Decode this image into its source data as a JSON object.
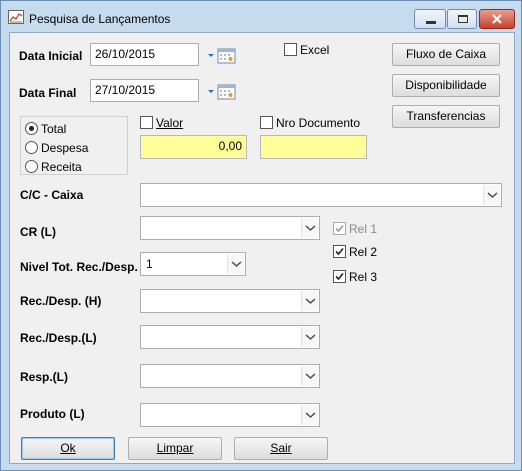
{
  "window": {
    "title": "Pesquisa de Lançamentos"
  },
  "dates": {
    "initial_label": "Data Inicial",
    "initial_value": "26/10/2015",
    "final_label": "Data Final",
    "final_value": "27/10/2015"
  },
  "excel": {
    "label": "Excel",
    "checked": false
  },
  "side_buttons": {
    "fluxo": "Fluxo de Caixa",
    "disponibilidade": "Disponibilidade",
    "transferencias": "Transferencias"
  },
  "type_group": {
    "options": [
      "Total",
      "Despesa",
      "Receita"
    ],
    "selected": "Total"
  },
  "valor": {
    "label": "Valor",
    "checked": false,
    "value": "0,00"
  },
  "nro_documento": {
    "label": "Nro Documento",
    "checked": false,
    "value": ""
  },
  "fields": {
    "cc_caixa": "C/C - Caixa",
    "cr": "CR (L)",
    "nivel": "Nivel Tot. Rec./Desp.",
    "nivel_value": "1",
    "recdesp_h": "Rec./Desp. (H)",
    "recdesp_l": "Rec./Desp.(L)",
    "resp": "Resp.(L)",
    "produto": "Produto (L)"
  },
  "rel": {
    "rel1": {
      "label": "Rel 1",
      "checked": true,
      "enabled": false
    },
    "rel2": {
      "label": "Rel 2",
      "checked": true,
      "enabled": true
    },
    "rel3": {
      "label": "Rel 3",
      "checked": true,
      "enabled": true
    }
  },
  "footer": {
    "ok": "Ok",
    "limpar": "Limpar",
    "sair": "Sair"
  },
  "colors": {
    "highlight_field": "#ffff99",
    "title_bar": "#c7dbef",
    "close_button": "#c6412a"
  }
}
